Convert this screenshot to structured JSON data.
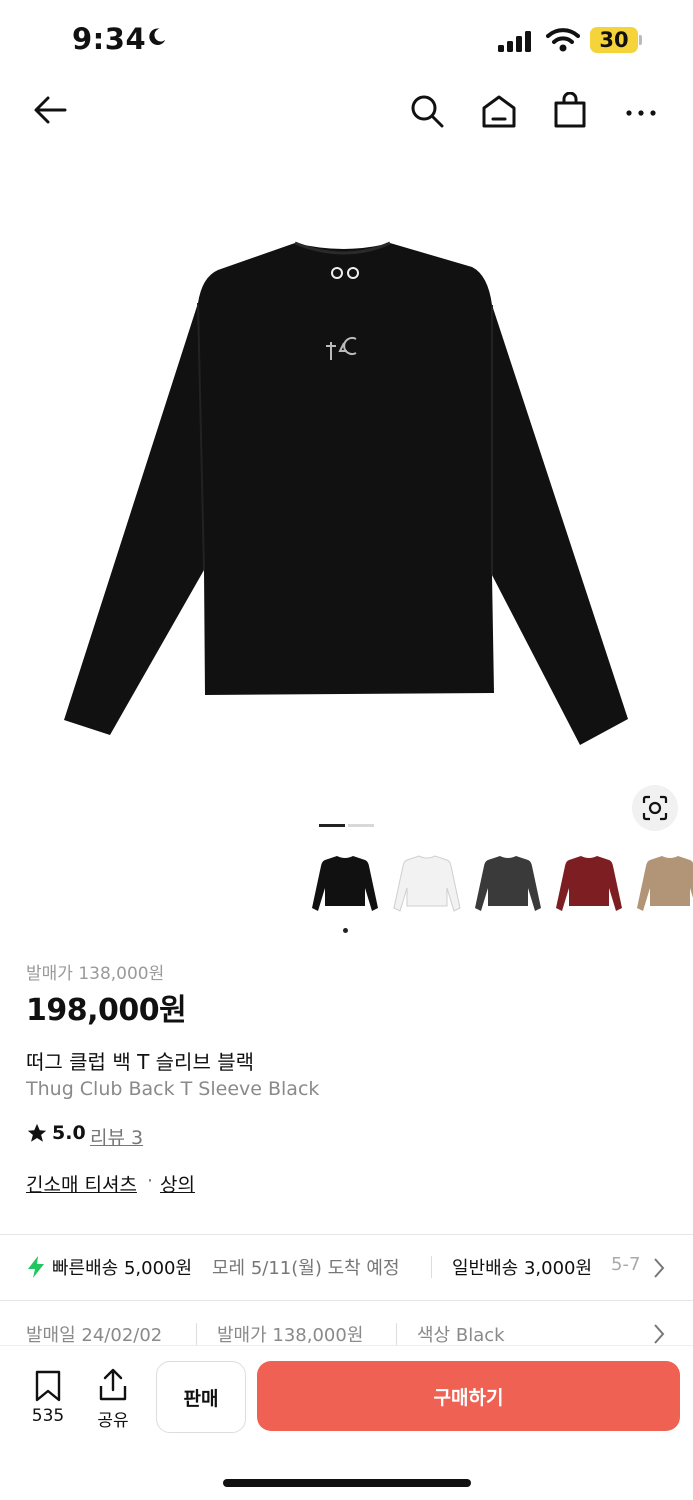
{
  "status_bar": {
    "time": "9:34",
    "battery": "30"
  },
  "product": {
    "release_price_label": "발매가 138,000원",
    "price": "198,000원",
    "title_ko": "떠그 클럽 백 T 슬리브 블랙",
    "title_en": "Thug Club Back T Sleeve Black",
    "rating": "5.0",
    "review_link": "리뷰 3",
    "category_1": "긴소매 티셔츠",
    "category_sep": "·",
    "category_2": "상의"
  },
  "thumbnail_colors": [
    "#111111",
    "#f2f2f2",
    "#3a3a3a",
    "#7d1f22",
    "#b19576"
  ],
  "shipping": {
    "fast_label": "빠른배송 5,000원",
    "fast_eta": "모레 5/11(월) 도착 예정",
    "normal_label": "일반배송 3,000원",
    "normal_eta": "5-7"
  },
  "meta": {
    "release_date": "발매일 24/02/02",
    "release_price": "발매가 138,000원",
    "color": "색상 Black"
  },
  "bottom_bar": {
    "bookmark_count": "535",
    "share_label": "공유",
    "sell_label": "판매",
    "buy_label": "구매하기"
  },
  "colors": {
    "accent": "#ef6253",
    "lightning": "#22c55e"
  }
}
